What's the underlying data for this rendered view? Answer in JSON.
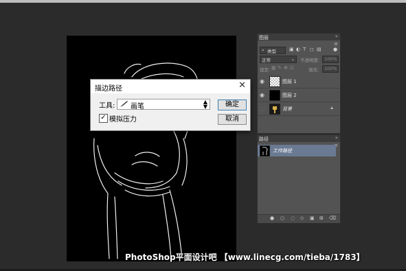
{
  "dialog": {
    "title": "描边路径",
    "close_glyph": "✕",
    "tool_label": "工具:",
    "tool_value": "画笔",
    "simulate_pressure_label": "模拟压力",
    "simulate_pressure_checked": true,
    "ok_label": "确定",
    "cancel_label": "取消"
  },
  "layers_panel": {
    "tab": "图层",
    "filter_value": "类型",
    "blend_mode": "正常",
    "opacity_label": "不透明度:",
    "opacity_value": "100%",
    "lock_label": "锁定:",
    "fill_label": "填充:",
    "fill_value": "100%",
    "layers": [
      {
        "name": "图层 1",
        "visible": true,
        "thumb": "checker"
      },
      {
        "name": "图层 2",
        "visible": true,
        "thumb": "black"
      },
      {
        "name": "背景",
        "visible": false,
        "thumb": "image",
        "locked": true
      }
    ]
  },
  "paths_panel": {
    "tab": "路径",
    "paths": [
      {
        "name": "工作路径",
        "selected": true
      }
    ]
  },
  "watermark": "PhotoShop平面设计吧 【www.linecg.com/tieba/1783】"
}
